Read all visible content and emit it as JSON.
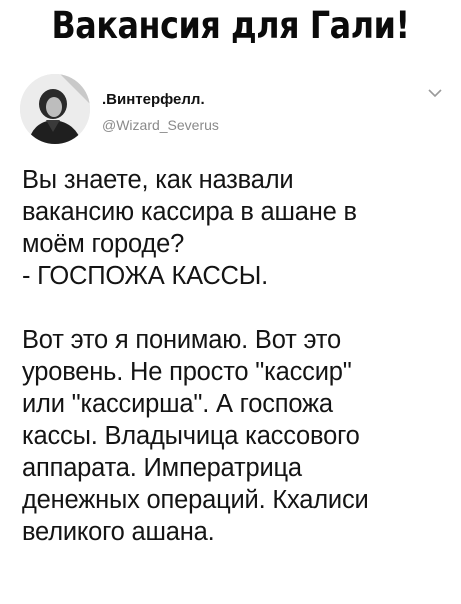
{
  "headline": "Вакансия для Гали!",
  "tweet": {
    "author_name": ".Винтерфелл.",
    "author_handle": "@Wizard_Severus",
    "paragraphs": [
      "Вы знаете, как назвали\nвакансию кассира в ашане в\nмоём городе?\n- ГОСПОЖА КАССЫ.",
      "Вот это я понимаю. Вот это\nуровень. Не просто \"кассир\"\nили \"кассирша\". А госпожа\nкассы. Владычица кассового\nаппарата. Императрица\nденежных операций. Кхалиси\nвеликого ашана."
    ]
  },
  "icons": {
    "avatar": "user-avatar-photo",
    "menu": "chevron-down-icon"
  },
  "colors": {
    "text": "#141414",
    "handle": "#8a8a8a",
    "background": "#ffffff"
  }
}
